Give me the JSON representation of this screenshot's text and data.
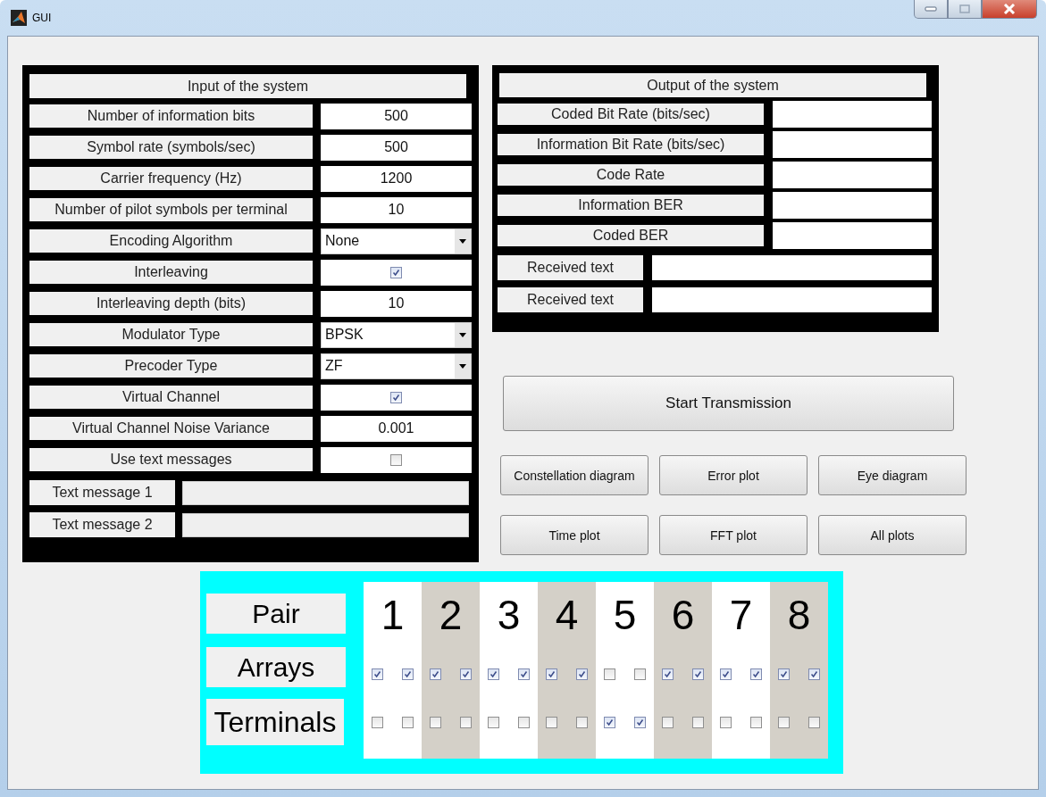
{
  "window": {
    "title": "GUI"
  },
  "input_panel": {
    "title": "Input of the system",
    "rows": [
      {
        "kind": "text",
        "label": "Number of information bits",
        "value": "500"
      },
      {
        "kind": "text",
        "label": "Symbol rate (symbols/sec)",
        "value": "500"
      },
      {
        "kind": "text",
        "label": "Carrier frequency (Hz)",
        "value": "1200"
      },
      {
        "kind": "text",
        "label": "Number of pilot symbols per terminal",
        "value": "10"
      },
      {
        "kind": "dropdown",
        "label": "Encoding Algorithm",
        "value": "None"
      },
      {
        "kind": "checkbox",
        "label": "Interleaving",
        "checked": true
      },
      {
        "kind": "text",
        "label": "Interleaving depth (bits)",
        "value": "10"
      },
      {
        "kind": "dropdown",
        "label": "Modulator Type",
        "value": "BPSK"
      },
      {
        "kind": "dropdown",
        "label": "Precoder Type",
        "value": "ZF"
      },
      {
        "kind": "checkbox",
        "label": "Virtual Channel",
        "checked": true
      },
      {
        "kind": "text",
        "label": "Virtual Channel Noise Variance",
        "value": "0.001"
      },
      {
        "kind": "checkbox",
        "label": "Use text messages",
        "checked": false
      }
    ],
    "messages": [
      {
        "label": "Text message 1",
        "disabled": true
      },
      {
        "label": "Text message 2",
        "disabled": true
      }
    ]
  },
  "output_panel": {
    "title": "Output of the system",
    "rows": [
      {
        "label": "Coded Bit Rate (bits/sec)"
      },
      {
        "label": "Information Bit Rate (bits/sec)"
      },
      {
        "label": "Code Rate"
      },
      {
        "label": "Information BER"
      },
      {
        "label": "Coded BER"
      }
    ],
    "received": [
      {
        "label": "Received text",
        "disabled": false
      },
      {
        "label": "Received text",
        "disabled": false
      }
    ]
  },
  "start_button": "Start Transmission",
  "plot_buttons": [
    "Constellation diagram",
    "Error plot",
    "Eye diagram",
    "Time plot",
    "FFT plot",
    "All plots"
  ],
  "pairs_panel": {
    "row_labels": [
      "Pair",
      "Arrays",
      "Terminals"
    ],
    "pairs": [
      {
        "label": "1",
        "arrays": [
          true,
          true
        ],
        "terminals": [
          false,
          false
        ]
      },
      {
        "label": "2",
        "arrays": [
          true,
          true
        ],
        "terminals": [
          false,
          false
        ]
      },
      {
        "label": "3",
        "arrays": [
          true,
          true
        ],
        "terminals": [
          false,
          false
        ]
      },
      {
        "label": "4",
        "arrays": [
          true,
          true
        ],
        "terminals": [
          false,
          false
        ]
      },
      {
        "label": "5",
        "arrays": [
          false,
          false
        ],
        "terminals": [
          true,
          true
        ]
      },
      {
        "label": "6",
        "arrays": [
          true,
          true
        ],
        "terminals": [
          false,
          false
        ]
      },
      {
        "label": "7",
        "arrays": [
          true,
          true
        ],
        "terminals": [
          false,
          false
        ]
      },
      {
        "label": "8",
        "arrays": [
          true,
          true
        ],
        "terminals": [
          false,
          false
        ]
      }
    ]
  }
}
